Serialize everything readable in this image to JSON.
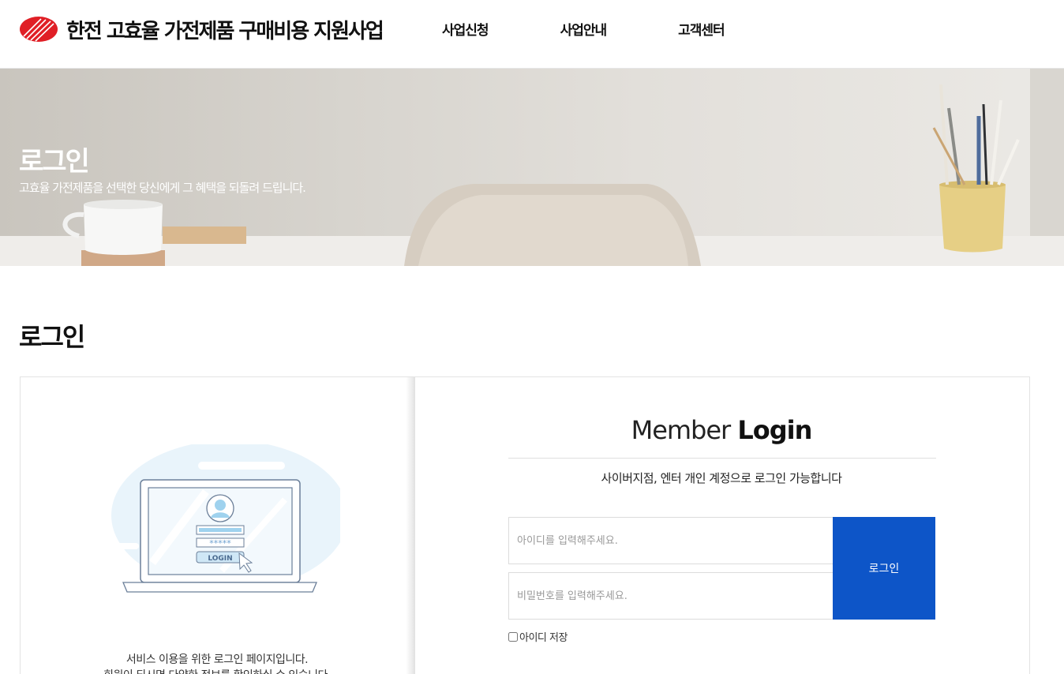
{
  "header": {
    "logo_text": "한전 고효율 가전제품 구매비용 지원사업",
    "nav": [
      "사업신청",
      "사업안내",
      "고객센터"
    ]
  },
  "hero": {
    "title": "로그인",
    "subtitle": "고효율 가전제품을 선택한 당신에게 그 혜택을 되돌려 드립니다."
  },
  "page": {
    "title": "로그인"
  },
  "login": {
    "title_light": "Member ",
    "title_bold": "Login",
    "description": "사이버지점, 엔터 개인 계정으로 로그인 가능합니다",
    "id_placeholder": "아이디를 입력해주세요.",
    "pw_placeholder": "비밀번호를 입력해주세요.",
    "button_label": "로그인",
    "remember_label": "아이디 저장",
    "illustration_button": "LOGIN",
    "illustration_password": "*****",
    "left_desc": [
      "서비스 이용을 위한 로그인 페이지입니다.",
      "회원이 되시면 다양한 정보를 확인하실 수 있습니다."
    ]
  },
  "colors": {
    "brand_red": "#e01f26",
    "button_blue": "#0d55c8"
  },
  "icons": [
    "kepco-logo-icon",
    "user-avatar-icon",
    "cursor-icon",
    "laptop-icon"
  ]
}
